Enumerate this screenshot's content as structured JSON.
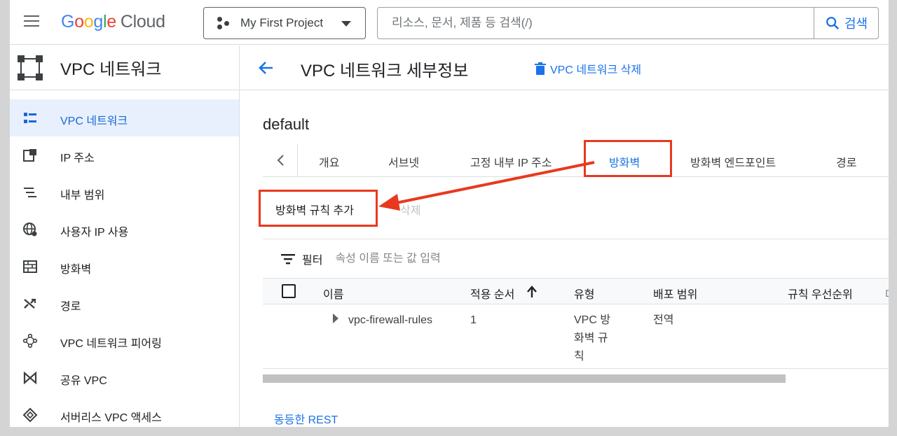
{
  "header": {
    "logo_google": "Google",
    "logo_cloud": "Cloud",
    "project_name": "My First Project",
    "search_placeholder": "리소스, 문서, 제품 등 검색(/)",
    "search_button": "검색"
  },
  "sidebar": {
    "title": "VPC 네트워크",
    "items": [
      {
        "label": "VPC 네트워크",
        "icon": "vpc-network-icon",
        "active": true
      },
      {
        "label": "IP 주소",
        "icon": "ip-address-icon"
      },
      {
        "label": "내부 범위",
        "icon": "internal-range-icon"
      },
      {
        "label": "사용자 IP 사용",
        "icon": "globe-icon"
      },
      {
        "label": "방화벽",
        "icon": "firewall-icon"
      },
      {
        "label": "경로",
        "icon": "routes-icon"
      },
      {
        "label": "VPC 네트워크 피어링",
        "icon": "peering-icon"
      },
      {
        "label": "공유 VPC",
        "icon": "shared-vpc-icon"
      },
      {
        "label": "서버리스 VPC 액세스",
        "icon": "serverless-icon"
      }
    ]
  },
  "page": {
    "title": "VPC 네트워크 세부정보",
    "delete_link": "VPC 네트워크 삭제",
    "network_name": "default"
  },
  "tabs": [
    "개요",
    "서브넷",
    "고정 내부 IP 주소",
    "방화벽",
    "방화벽 엔드포인트",
    "경로"
  ],
  "active_tab": "방화벽",
  "actions": {
    "add_rule": "방화벽 규칙 추가",
    "delete": "삭제"
  },
  "filter": {
    "label": "필터",
    "placeholder": "속성 이름 또는 값 입력"
  },
  "table": {
    "columns": [
      "이름",
      "적용 순서",
      "유형",
      "배포 범위",
      "규칙 우선순위",
      "대"
    ],
    "rows": [
      {
        "name": "vpc-firewall-rules",
        "order": "1",
        "type_l1": "VPC 방",
        "type_l2": "화벽 규",
        "type_l3": "칙",
        "scope": "전역"
      }
    ]
  },
  "equivalent_rest": "동등한 REST",
  "colors": {
    "accent": "#1a73e8",
    "highlight": "#e8391f"
  }
}
